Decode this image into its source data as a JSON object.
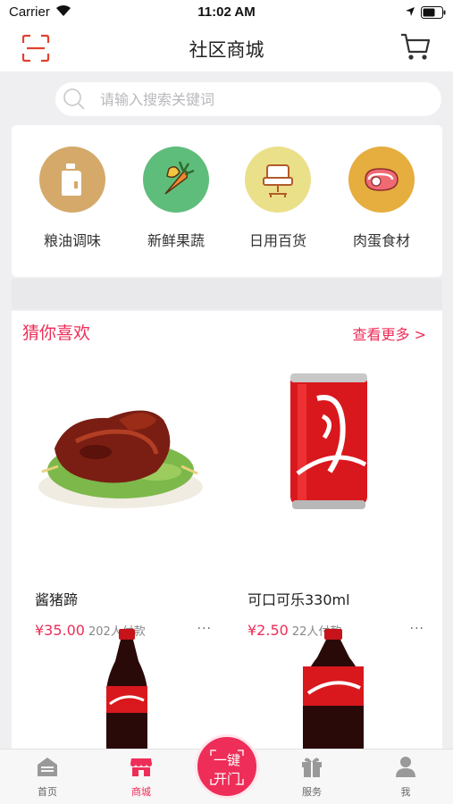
{
  "status_bar": {
    "carrier": "Carrier",
    "time": "11:02 AM"
  },
  "header": {
    "title": "社区商城",
    "scan_icon": "scan-icon",
    "cart_icon": "cart-icon"
  },
  "search": {
    "placeholder": "请输入搜索关键词"
  },
  "categories": [
    {
      "label": "粮油调味",
      "icon": "oil-bottle-icon",
      "color": "#d4a96a"
    },
    {
      "label": "新鲜果蔬",
      "icon": "carrot-icon",
      "color": "#5fbd7c"
    },
    {
      "label": "日用百货",
      "icon": "chair-icon",
      "color": "#ebe08a"
    },
    {
      "label": "肉蛋食材",
      "icon": "meat-icon",
      "color": "#e6ad3f"
    }
  ],
  "recommend": {
    "title": "猜你喜欢",
    "more": "查看更多 >",
    "products": [
      {
        "name": "酱猪蹄",
        "price": "¥35.00",
        "sales": "202人付款",
        "more": "···"
      },
      {
        "name": "可口可乐330ml",
        "price": "¥2.50",
        "sales": "22人付款",
        "more": "···"
      }
    ]
  },
  "tabbar": {
    "tabs": [
      {
        "label": "首页",
        "icon": "home-icon"
      },
      {
        "label": "商城",
        "icon": "store-icon"
      },
      {
        "label": "服务",
        "icon": "gift-icon"
      },
      {
        "label": "我",
        "icon": "person-icon"
      }
    ],
    "center_button": {
      "line1": "一键",
      "line2": "开门"
    },
    "active_index": 1
  },
  "colors": {
    "accent": "#ee2d58",
    "background": "#efeff1"
  }
}
